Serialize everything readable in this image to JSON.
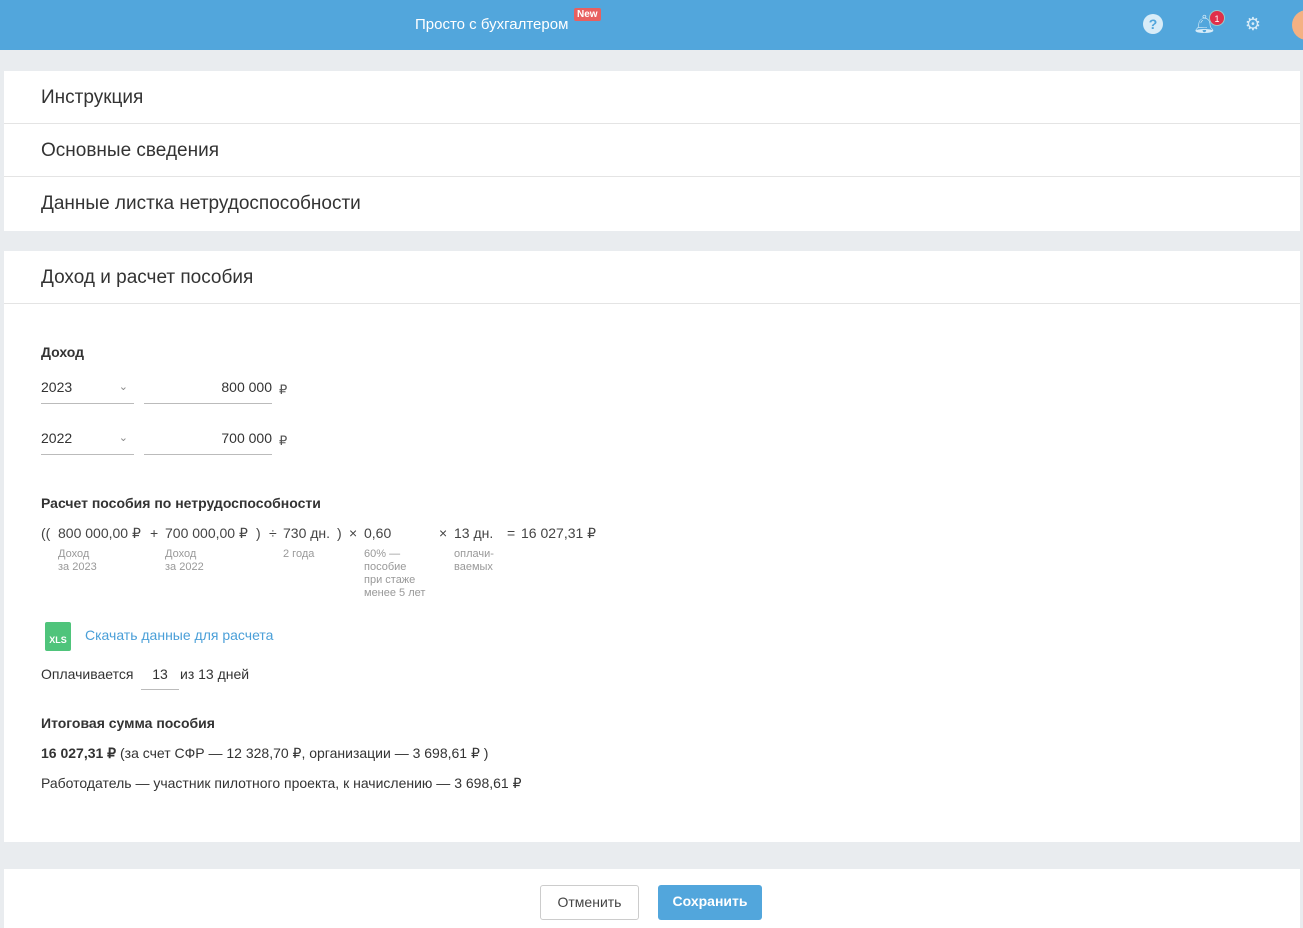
{
  "header": {
    "brand": "Просто с бухгалтером",
    "new_badge": "New",
    "notifications": "1"
  },
  "sections": {
    "instruction": "Инструкция",
    "main_info": "Основные сведения",
    "sick_leave": "Данные листка нетрудоспособности",
    "income_calc": "Доход и расчет пособия"
  },
  "income": {
    "label": "Доход",
    "rows": [
      {
        "year": "2023",
        "amount": "800 000",
        "currency": "₽"
      },
      {
        "year": "2022",
        "amount": "700 000",
        "currency": "₽"
      }
    ]
  },
  "calc": {
    "label": "Расчет пособия по нетрудоспособности",
    "open": "((",
    "income1": "800 000,00 ₽",
    "plus": "+",
    "income2": "700 000,00 ₽",
    "close1": ")",
    "div": "÷",
    "days": "730 дн.",
    "close2": ")",
    "mul1": "×",
    "rate": "0,60",
    "mul2": "×",
    "paid_days": "13 дн.",
    "eq": "=",
    "result": "16 027,31 ₽",
    "sub_income1": "Доход\nза 2023",
    "sub_income2": "Доход\nза 2022",
    "sub_days": "2 года",
    "sub_rate": "60% —\nпособие\nпри стаже\nменее 5 лет",
    "sub_paid": "оплачи-\nваемых"
  },
  "download": {
    "icon_text": "XLS",
    "label": "Скачать данные для расчета"
  },
  "paid": {
    "prefix": "Оплачивается",
    "value": "13",
    "suffix": "из 13 дней"
  },
  "total": {
    "label": "Итоговая сумма пособия",
    "amount": "16 027,31 ₽",
    "details": " (за счет СФР — 12 328,70 ₽, организации — 3 698,61 ₽ )",
    "pilot": "Работодатель — участник пилотного проекта, к начислению — 3 698,61 ₽"
  },
  "buttons": {
    "cancel": "Отменить",
    "save": "Сохранить"
  }
}
